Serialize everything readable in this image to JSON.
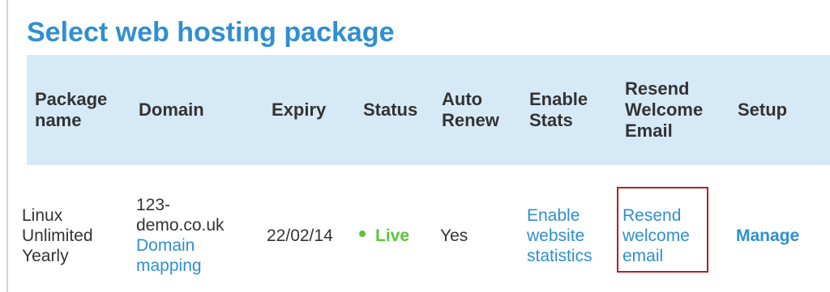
{
  "page": {
    "title": "Select web hosting package"
  },
  "table": {
    "headers": {
      "package_name": [
        "Package",
        "name"
      ],
      "domain": [
        "Domain"
      ],
      "expiry": [
        "Expiry"
      ],
      "status": [
        "Status"
      ],
      "auto_renew": [
        "Auto",
        "Renew"
      ],
      "enable_stats": [
        "Enable",
        "Stats"
      ],
      "resend_welcome_email": [
        "Resend",
        "Welcome",
        "Email"
      ],
      "setup": [
        "Setup"
      ]
    },
    "row": {
      "package_name": [
        "Linux",
        "Unlimited",
        "Yearly"
      ],
      "domain": [
        "123-",
        "demo.co.uk"
      ],
      "domain_mapping_link": [
        "Domain",
        "mapping"
      ],
      "expiry": "22/02/14",
      "status": "Live",
      "auto_renew": "Yes",
      "enable_stats_link": [
        "Enable",
        "website",
        "statistics"
      ],
      "resend_link": [
        "Resend",
        "welcome",
        "email"
      ],
      "setup_link": "Manage"
    }
  },
  "colors": {
    "accent": "#2f8fd1",
    "header_background": "#d6e9f7",
    "status_live": "#5cc43d",
    "highlight_border": "#b91d24"
  },
  "icons": {
    "status": "status-dot-icon"
  }
}
